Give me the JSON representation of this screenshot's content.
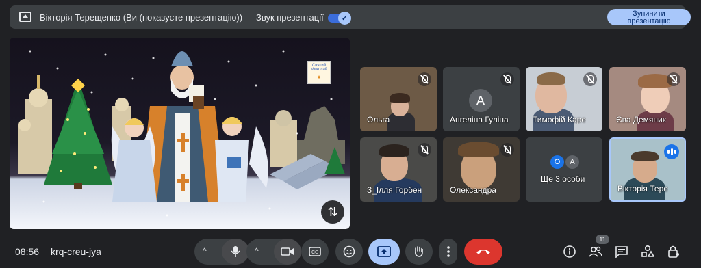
{
  "topbar": {
    "presenter_title": "Вікторія Терещенко (Ви (показуєте презентацію))",
    "audio_label": "Звук презентації",
    "audio_checked_glyph": "✓",
    "stop_line1": "Зупинити",
    "stop_line2": "презентацію"
  },
  "presentation": {
    "sign_text": "Святий Миколай",
    "swap_icon": "⇅"
  },
  "tiles": [
    {
      "name": "Ольга",
      "muted": true
    },
    {
      "name": "Ангеліна Гуліна",
      "initial": "A",
      "muted": true
    },
    {
      "name": "Тимофій Каре",
      "muted": true
    },
    {
      "name": "Єва Демяник",
      "muted": true
    },
    {
      "name": "З_Ілля Горбен",
      "muted": true
    },
    {
      "name": "Олександра",
      "muted": true
    },
    {
      "name": "Ще 3 особи",
      "avatars": [
        "O",
        "A"
      ]
    },
    {
      "name": "Вікторія Тере",
      "speaking": true
    }
  ],
  "bottom": {
    "time": "08:56",
    "meeting_code": "krq-creu-jya",
    "caret": "^",
    "participants_count": "11"
  },
  "colors": {
    "accent": "#a8c7fa",
    "end_call": "#dc362e",
    "speaking": "#1a73e8"
  }
}
